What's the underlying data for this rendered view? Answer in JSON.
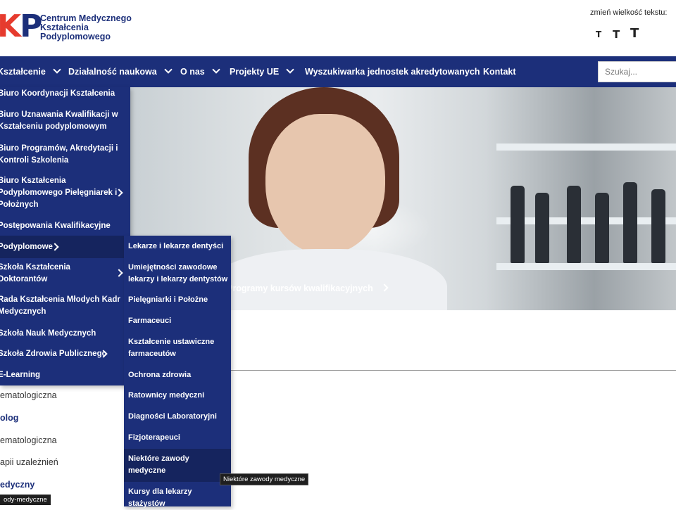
{
  "header": {
    "logo_mark_left": "K",
    "logo_mark_right": "P",
    "logo_line1": "Centrum Medycznego",
    "logo_line2": "Kształcenia",
    "logo_line3": "Podyplomowego",
    "font_size_label": "zmień wielkość tekstu:",
    "font_size_buttons": [
      "T",
      "T",
      "T"
    ]
  },
  "nav": {
    "items": [
      "Kształcenie",
      "Działalność naukowa",
      "O nas",
      "Projekty UE",
      "Wyszukiwarka jednostek akredytowanych",
      "Kontakt"
    ],
    "search_placeholder": "Szukaj..."
  },
  "menu1": {
    "items": [
      [
        "Biuro Koordynacji Kształcenia"
      ],
      [
        "Biuro Uznawania Kwalifikacji w",
        "Kształceniu podyplomowym"
      ],
      [
        "Biuro Programów, Akredytacji i",
        "Kontroli Szkolenia"
      ],
      [
        "Biuro Kształcenia",
        "Podyplomowego Pielęgniarek i",
        "Położnych"
      ],
      [
        "Postępowania Kwalifikacyjne"
      ],
      [
        "Podyplomowe"
      ],
      [
        "Szkoła Kształcenia",
        "Doktorantów"
      ],
      [
        "Rada Kształcenia Młodych Kadr",
        "Medycznych"
      ],
      [
        "Szkoła Nauk Medycznych"
      ],
      [
        "Szkoła Zdrowia Publicznego"
      ],
      [
        "E-Learning"
      ]
    ]
  },
  "menu2": {
    "items": [
      [
        "Lekarze i lekarze dentyści"
      ],
      [
        "Umiejętności zawodowe",
        "lekarzy i lekarzy dentystów"
      ],
      [
        "Pielęgniarki i Położne"
      ],
      [
        "Farmaceuci"
      ],
      [
        "Kształcenie ustawiczne",
        "farmaceutów"
      ],
      [
        "Ochrona zdrowia"
      ],
      [
        "Ratownicy medyczni"
      ],
      [
        "Diagności Laboratoryjni"
      ],
      [
        "Fizjoterapeuci"
      ],
      [
        "Niektóre zawody",
        "medyczne"
      ],
      [
        "Kursy dla lekarzy",
        "stażystów"
      ]
    ]
  },
  "hero": {
    "caption": "Programy kursów kwalifikacyjnych"
  },
  "background_links": [
    "ematologiczna",
    "olog",
    "ematologiczna",
    "apii uzależnień",
    "edyczny"
  ],
  "tooltip": "Niektóre zawody medyczne",
  "status_url": "ody-medyczne",
  "colors": {
    "brand_navy": "#1c2f7a",
    "active_navy": "#15245e",
    "logo_red": "#e63b2e"
  }
}
